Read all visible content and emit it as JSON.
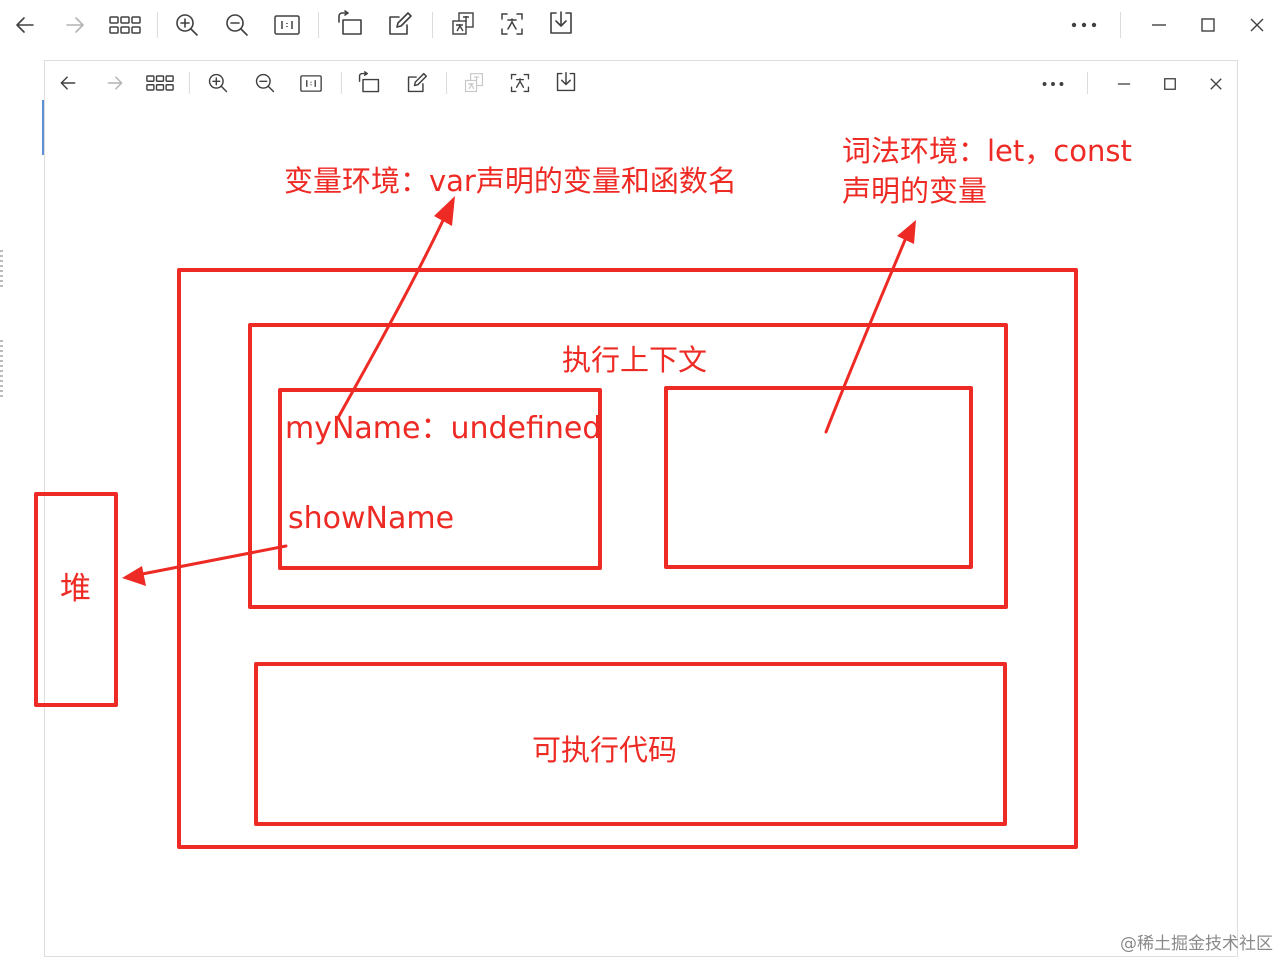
{
  "annotations": {
    "variable_env": "变量环境：var声明的变量和函数名",
    "lexical_env_line1": "词法环境：let，const",
    "lexical_env_line2": "声明的变量",
    "exec_context": "执行上下文",
    "var_myname": "myName：undefined",
    "var_showname": "showName",
    "heap": "堆",
    "executable_code": "可执行代码"
  },
  "watermark": "@稀土掘金技术社区",
  "colors": {
    "annotation_red": "#ee2a24",
    "toolbar_icon": "#404040",
    "toolbar_icon_disabled": "#b4b4b4"
  },
  "toolbar_icons": [
    "back-arrow-icon",
    "forward-arrow-icon",
    "grid-view-icon",
    "zoom-in-icon",
    "zoom-out-icon",
    "actual-size-icon",
    "rotate-icon",
    "edit-icon",
    "translate-icon",
    "ocr-icon",
    "download-icon",
    "more-icon",
    "minimize-icon",
    "maximize-icon",
    "close-icon"
  ]
}
